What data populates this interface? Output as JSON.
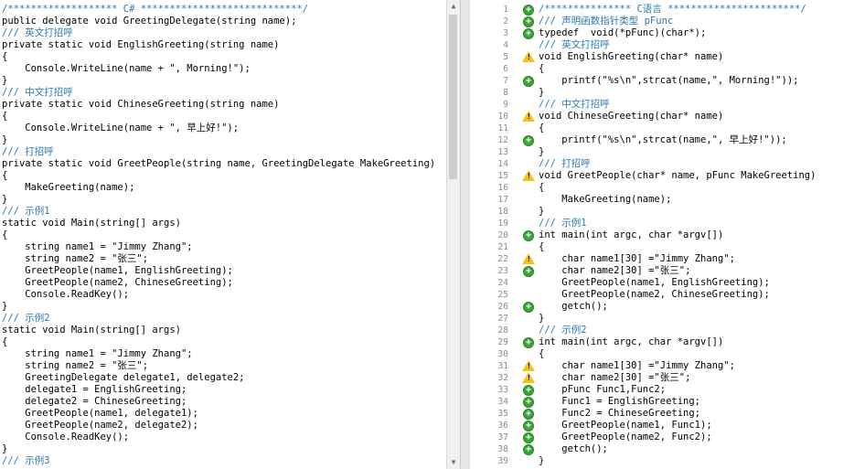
{
  "left": {
    "lines": [
      {
        "t": "/******************* C# ****************************/",
        "cls": "c"
      },
      {
        "t": "public delegate void GreetingDelegate(string name);"
      },
      {
        "t": "/// 英文打招呼",
        "cls": "c"
      },
      {
        "t": "private static void EnglishGreeting(string name)"
      },
      {
        "t": "{"
      },
      {
        "t": "    Console.WriteLine(name + \", Morning!\");"
      },
      {
        "t": "}"
      },
      {
        "t": "/// 中文打招呼",
        "cls": "c"
      },
      {
        "t": "private static void ChineseGreeting(string name)"
      },
      {
        "t": "{"
      },
      {
        "t": "    Console.WriteLine(name + \", 早上好!\");"
      },
      {
        "t": "}"
      },
      {
        "t": "/// 打招呼",
        "cls": "c"
      },
      {
        "t": "private static void GreetPeople(string name, GreetingDelegate MakeGreeting)"
      },
      {
        "t": "{"
      },
      {
        "t": "    MakeGreeting(name);"
      },
      {
        "t": "}"
      },
      {
        "t": "/// 示例1",
        "cls": "c"
      },
      {
        "t": "static void Main(string[] args)"
      },
      {
        "t": "{"
      },
      {
        "t": "    string name1 = \"Jimmy Zhang\";"
      },
      {
        "t": "    string name2 = \"张三\";"
      },
      {
        "t": "    GreetPeople(name1, EnglishGreeting);"
      },
      {
        "t": "    GreetPeople(name2, ChineseGreeting);"
      },
      {
        "t": "    Console.ReadKey();"
      },
      {
        "t": "}"
      },
      {
        "t": "/// 示例2",
        "cls": "c"
      },
      {
        "t": "static void Main(string[] args)"
      },
      {
        "t": "{"
      },
      {
        "t": "    string name1 = \"Jimmy Zhang\";"
      },
      {
        "t": "    string name2 = \"张三\";"
      },
      {
        "t": "    GreetingDelegate delegate1, delegate2;"
      },
      {
        "t": "    delegate1 = EnglishGreeting;"
      },
      {
        "t": "    delegate2 = ChineseGreeting;"
      },
      {
        "t": "    GreetPeople(name1, delegate1);"
      },
      {
        "t": "    GreetPeople(name2, delegate2);"
      },
      {
        "t": "    Console.ReadKey();"
      },
      {
        "t": "}"
      },
      {
        "t": "/// 示例3",
        "cls": "c"
      }
    ]
  },
  "right": {
    "lines": [
      {
        "n": "1",
        "m": "ok",
        "t": "/*************** C语言 ***********************/",
        "cls": "c"
      },
      {
        "n": "2",
        "m": "ok",
        "t": "/// 声明函数指针类型 pFunc",
        "cls": "c"
      },
      {
        "n": "3",
        "m": "ok",
        "t": "typedef  void(*pFunc)(char*);"
      },
      {
        "n": "4",
        "m": "",
        "t": "/// 英文打招呼",
        "cls": "c"
      },
      {
        "n": "5",
        "m": "warn",
        "t": "void EnglishGreeting(char* name)"
      },
      {
        "n": "6",
        "m": "",
        "t": "{"
      },
      {
        "n": "7",
        "m": "ok",
        "t": "    printf(\"%s\\n\",strcat(name,\", Morning!\"));"
      },
      {
        "n": "8",
        "m": "",
        "t": "}"
      },
      {
        "n": "9",
        "m": "",
        "t": "/// 中文打招呼",
        "cls": "c"
      },
      {
        "n": "10",
        "m": "warn",
        "t": "void ChineseGreeting(char* name)"
      },
      {
        "n": "11",
        "m": "",
        "t": "{"
      },
      {
        "n": "12",
        "m": "ok",
        "t": "    printf(\"%s\\n\",strcat(name,\", 早上好!\"));"
      },
      {
        "n": "13",
        "m": "",
        "t": "}"
      },
      {
        "n": "14",
        "m": "",
        "t": "/// 打招呼",
        "cls": "c"
      },
      {
        "n": "15",
        "m": "warn",
        "t": "void GreetPeople(char* name, pFunc MakeGreeting)"
      },
      {
        "n": "16",
        "m": "",
        "t": "{"
      },
      {
        "n": "17",
        "m": "",
        "t": "    MakeGreeting(name);"
      },
      {
        "n": "18",
        "m": "",
        "t": "}"
      },
      {
        "n": "19",
        "m": "",
        "t": "/// 示例1",
        "cls": "c"
      },
      {
        "n": "20",
        "m": "ok",
        "t": "int main(int argc, char *argv[])"
      },
      {
        "n": "21",
        "m": "",
        "t": "{"
      },
      {
        "n": "22",
        "m": "warn",
        "t": "    char name1[30] =\"Jimmy Zhang\";"
      },
      {
        "n": "23",
        "m": "ok",
        "t": "    char name2[30] =\"张三\";"
      },
      {
        "n": "24",
        "m": "",
        "t": "    GreetPeople(name1, EnglishGreeting);"
      },
      {
        "n": "25",
        "m": "",
        "t": "    GreetPeople(name2, ChineseGreeting);"
      },
      {
        "n": "26",
        "m": "ok",
        "t": "    getch();"
      },
      {
        "n": "27",
        "m": "",
        "t": "}"
      },
      {
        "n": "28",
        "m": "",
        "t": "/// 示例2",
        "cls": "c"
      },
      {
        "n": "29",
        "m": "ok",
        "t": "int main(int argc, char *argv[])"
      },
      {
        "n": "30",
        "m": "",
        "t": "{"
      },
      {
        "n": "31",
        "m": "warn",
        "t": "    char name1[30] =\"Jimmy Zhang\";"
      },
      {
        "n": "32",
        "m": "warn",
        "t": "    char name2[30] =\"张三\";"
      },
      {
        "n": "33",
        "m": "ok",
        "t": "    pFunc Func1,Func2;"
      },
      {
        "n": "34",
        "m": "ok",
        "t": "    Func1 = EnglishGreeting;"
      },
      {
        "n": "35",
        "m": "ok",
        "t": "    Func2 = ChineseGreeting;"
      },
      {
        "n": "36",
        "m": "ok",
        "t": "    GreetPeople(name1, Func1);"
      },
      {
        "n": "37",
        "m": "ok",
        "t": "    GreetPeople(name2, Func2);"
      },
      {
        "n": "38",
        "m": "ok",
        "t": "    getch();"
      },
      {
        "n": "39",
        "m": "",
        "t": "}"
      }
    ]
  },
  "icons": {
    "ok": "plus-circle-icon",
    "warn": "warning-icon"
  },
  "colors": {
    "comment": "#2a7ab0",
    "keyword": "#0000ff",
    "string": "#a31515",
    "ok": "#3aa637",
    "warn": "#f0c419"
  }
}
